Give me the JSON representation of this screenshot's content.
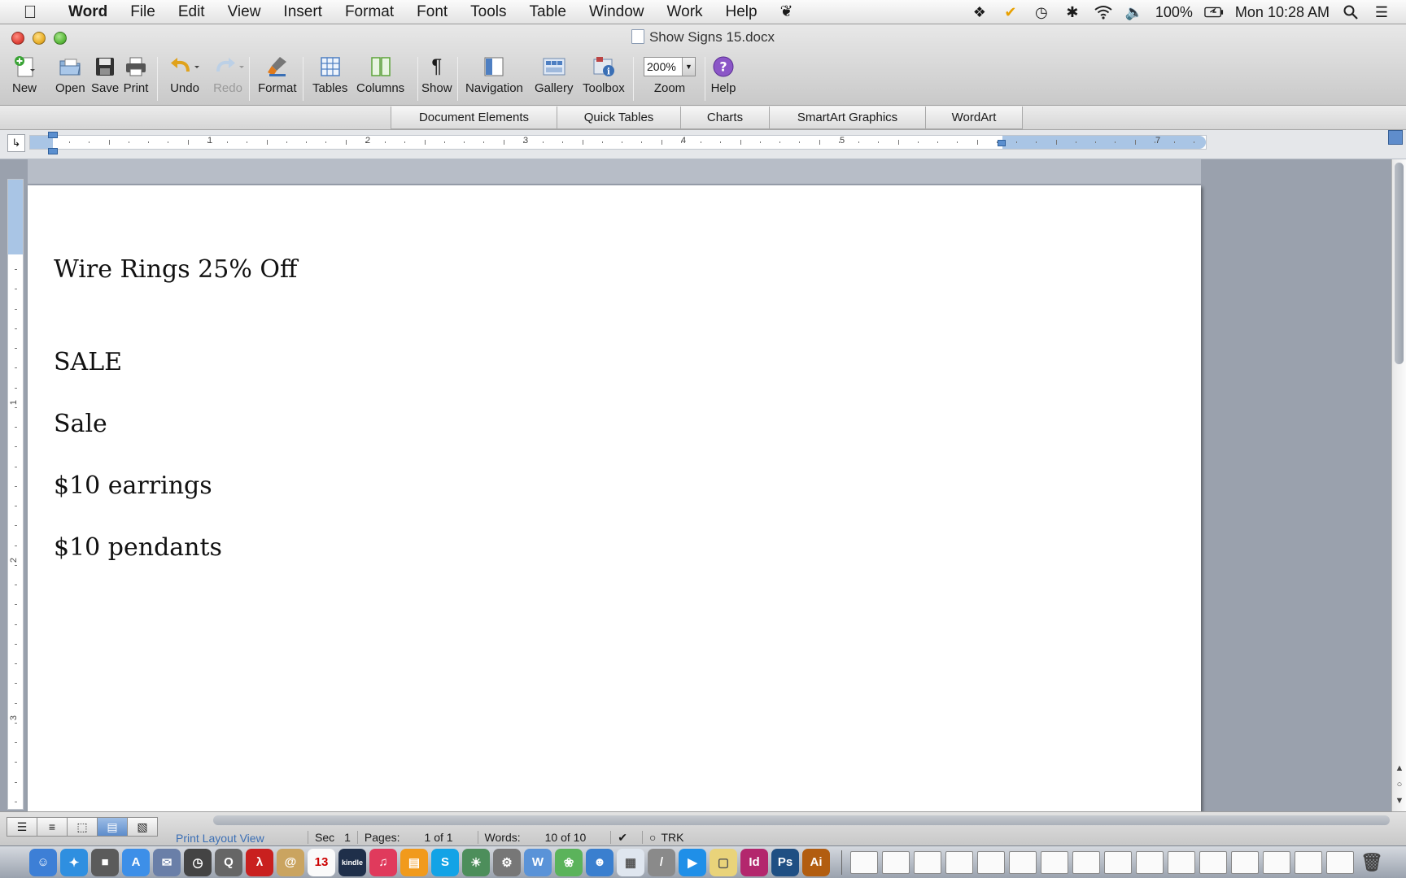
{
  "menubar": {
    "app_name": "Word",
    "items": [
      "File",
      "Edit",
      "View",
      "Insert",
      "Format",
      "Font",
      "Tools",
      "Table",
      "Window",
      "Work",
      "Help"
    ],
    "battery": "100%",
    "clock": "Mon 10:28 AM"
  },
  "window": {
    "title": "Show Signs 15.docx"
  },
  "toolbar": {
    "new": "New",
    "open": "Open",
    "save": "Save",
    "print": "Print",
    "undo": "Undo",
    "redo": "Redo",
    "format": "Format",
    "tables": "Tables",
    "columns": "Columns",
    "show": "Show",
    "navigation": "Navigation",
    "gallery": "Gallery",
    "toolbox": "Toolbox",
    "zoom_value": "200%",
    "zoom": "Zoom",
    "help": "Help"
  },
  "ribbon_tabs": [
    "Document Elements",
    "Quick Tables",
    "Charts",
    "SmartArt Graphics",
    "WordArt"
  ],
  "ruler": {
    "labels": [
      "1",
      "2",
      "3",
      "4",
      "5",
      "7"
    ],
    "vertical_labels": [
      "1",
      "2",
      "3"
    ]
  },
  "document": {
    "lines": [
      "Wire Rings 25% Off",
      "SALE",
      "Sale",
      "$10 earrings",
      "$10 pendants"
    ]
  },
  "statusbar": {
    "view_name": "Print Layout View",
    "sec_label": "Sec",
    "sec_value": "1",
    "pages_label": "Pages:",
    "pages_value": "1 of 1",
    "words_label": "Words:",
    "words_value": "10 of 10",
    "trk": "TRK"
  },
  "dock": {
    "kindle_label": "kindle",
    "calendar_day": "13",
    "apps": [
      "Id",
      "Ps",
      "Ai"
    ]
  },
  "colors": {
    "accent": "#5d8ccb",
    "page_bg": "#ffffff",
    "workspace": "#9aa1ad"
  }
}
